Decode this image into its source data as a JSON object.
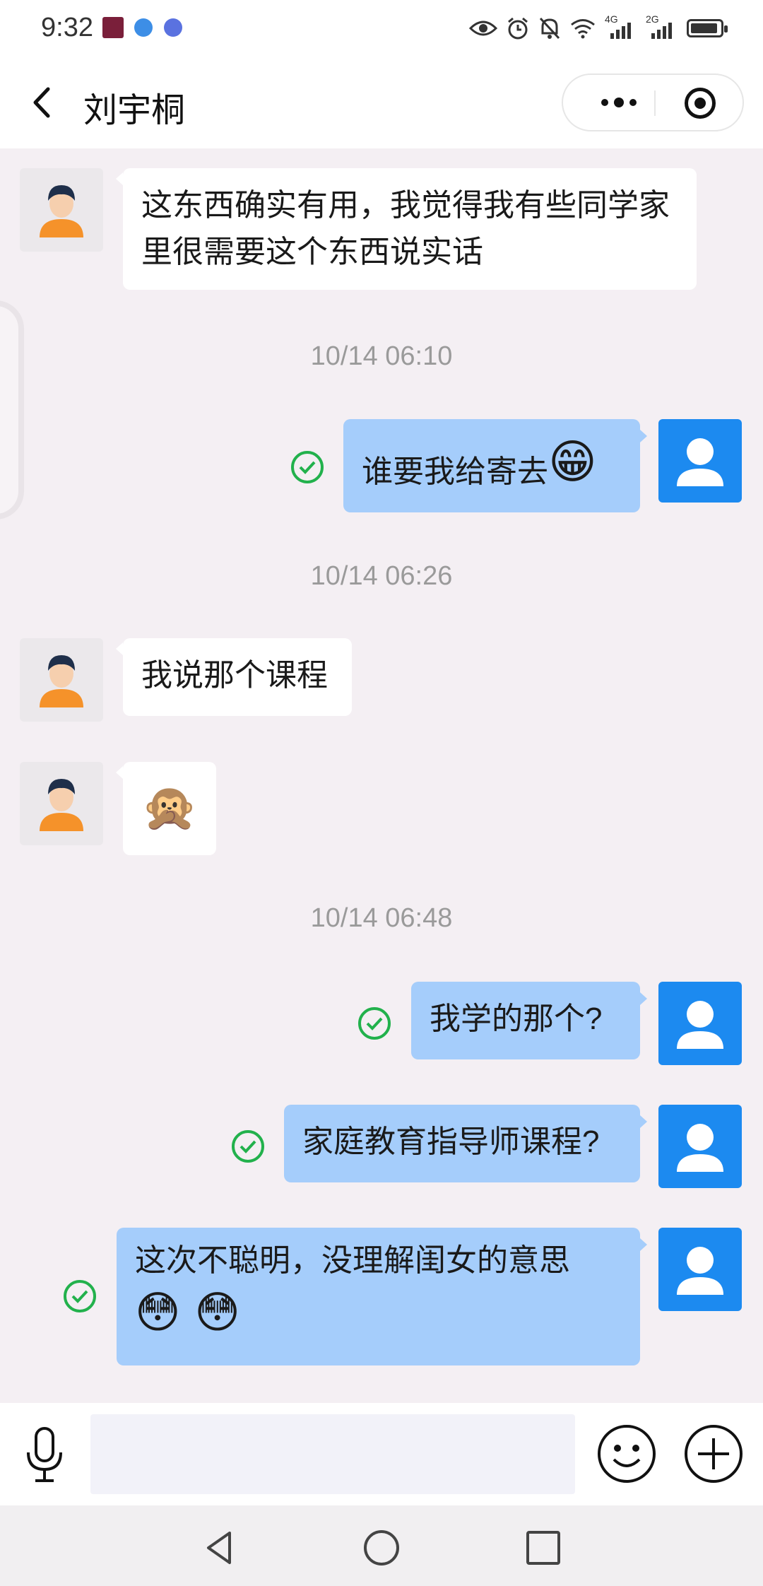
{
  "status_bar": {
    "time": "9:32",
    "signal_1_label": "4G",
    "signal_2_label": "2G"
  },
  "header": {
    "title": "刘宇桐"
  },
  "messages": [
    {
      "type": "message",
      "from": "other",
      "text": "这东西确实有用，我觉得我有些同学家里很需要这个东西说实话"
    },
    {
      "type": "time",
      "text": "10/14 06:10"
    },
    {
      "type": "message",
      "from": "me",
      "text": "谁要我给寄去",
      "emoji": "😁",
      "status": "sent"
    },
    {
      "type": "time",
      "text": "10/14 06:26"
    },
    {
      "type": "message",
      "from": "other",
      "text": "我说那个课程"
    },
    {
      "type": "message",
      "from": "other",
      "emoji": "🙊"
    },
    {
      "type": "time",
      "text": "10/14 06:48"
    },
    {
      "type": "message",
      "from": "me",
      "text": "我学的那个?",
      "status": "sent"
    },
    {
      "type": "message",
      "from": "me",
      "text": "家庭教育指导师课程?",
      "status": "sent"
    },
    {
      "type": "message",
      "from": "me",
      "text": "这次不聪明，没理解闺女的意思",
      "emoji": "😳 😳",
      "status": "sent"
    }
  ],
  "colors": {
    "my_bubble": "#a5cdfb",
    "my_avatar": "#1c8af0",
    "sent_check": "#22b14c",
    "chat_background": "#f4eff3"
  }
}
